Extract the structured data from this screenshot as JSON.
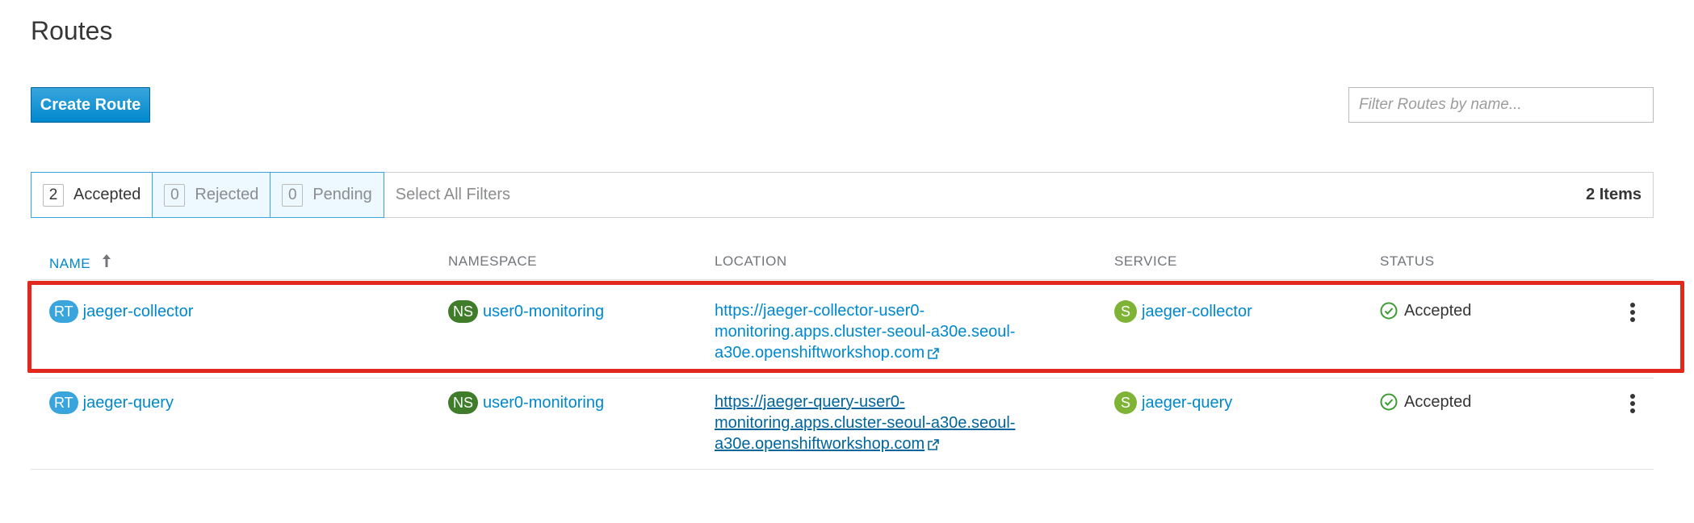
{
  "page": {
    "title": "Routes"
  },
  "toolbar": {
    "create_label": "Create Route",
    "filter_placeholder": "Filter Routes by name..."
  },
  "filters": {
    "toggles": [
      {
        "count": "2",
        "label": "Accepted"
      },
      {
        "count": "0",
        "label": "Rejected"
      },
      {
        "count": "0",
        "label": "Pending"
      }
    ],
    "select_all_label": "Select All Filters",
    "items_count": "2 Items"
  },
  "table": {
    "headers": [
      "NAME",
      "NAMESPACE",
      "LOCATION",
      "SERVICE",
      "STATUS"
    ],
    "sort_indicator": "↑",
    "rows": [
      {
        "name_badge": "RT",
        "name": "jaeger-collector",
        "ns_badge": "NS",
        "namespace": "user0-monitoring",
        "location_lines": [
          "https://jaeger-collector-user0-",
          "monitoring.apps.cluster-seoul-a30e.seoul-",
          "a30e.openshiftworkshop.com"
        ],
        "svc_badge": "S",
        "service": "jaeger-collector",
        "status": "Accepted"
      },
      {
        "name_badge": "RT",
        "name": "jaeger-query",
        "ns_badge": "NS",
        "namespace": "user0-monitoring",
        "location_lines": [
          "https://jaeger-query-user0-",
          "monitoring.apps.cluster-seoul-a30e.seoul-",
          "a30e.openshiftworkshop.com"
        ],
        "svc_badge": "S",
        "service": "jaeger-query",
        "status": "Accepted"
      }
    ]
  },
  "colors": {
    "primary": "#0088ce",
    "highlight": "#e0281c",
    "success": "#3f9c35",
    "ns_badge": "#3f7d2b",
    "rt_badge": "#39a5dc",
    "svc_badge": "#7fb336"
  },
  "icons": {
    "sort": "arrow-up-icon",
    "external_link": "external-link-icon",
    "status": "check-circle-icon",
    "row_actions": "kebab-menu-icon"
  }
}
